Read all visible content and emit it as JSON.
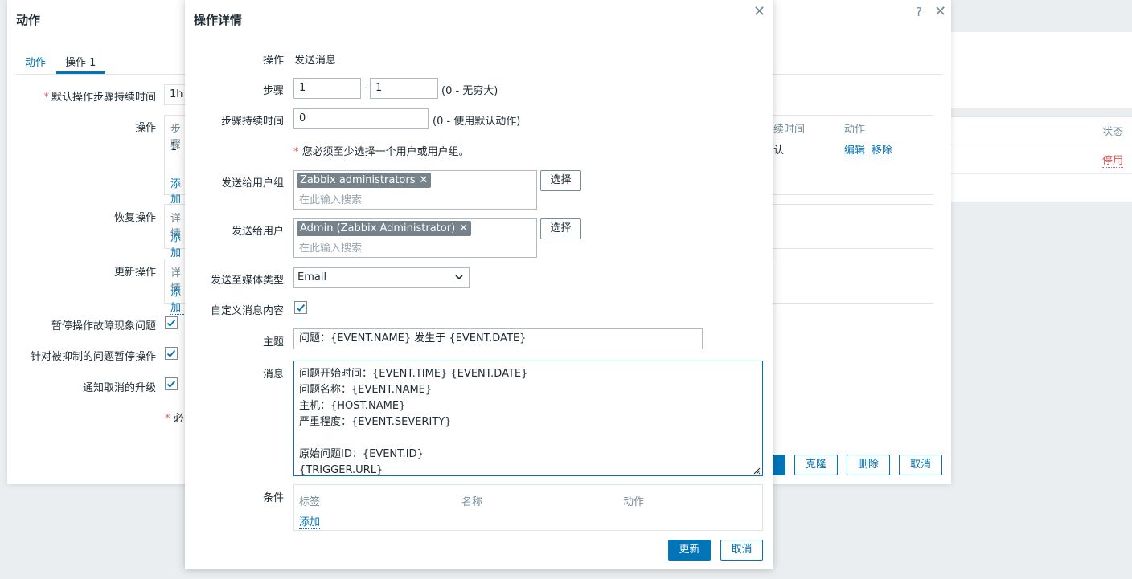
{
  "background": {
    "status_header": "状态",
    "status_value": "停用"
  },
  "back_dialog": {
    "title": "动作",
    "help_icon": "?",
    "tabs": [
      {
        "label": "动作"
      },
      {
        "label": "操作 1"
      }
    ],
    "default_duration_label": "默认操作步骤持续时间",
    "default_duration_value": "1h",
    "operations_label": "操作",
    "operations_table": {
      "col_steps_partial": "步骤",
      "row_step": "1",
      "col_duration_partial": "续时间",
      "col_action": "动作",
      "row_duration_partial": "认",
      "edit_link": "编辑",
      "remove_link": "移除",
      "add_partial": "添加"
    },
    "recovery_label": "恢复操作",
    "recovery_detail_partial": "详情",
    "recovery_add_partial": "添加",
    "update_label": "更新操作",
    "update_detail_partial": "详情",
    "update_add_partial": "添加",
    "pause_symptoms_label": "暂停操作故障现象问题",
    "pause_suppressed_label": "针对被抑制的问题暂停操作",
    "notify_cancel_label": "通知取消的升级",
    "required_note_partial": "必",
    "buttons": {
      "clone": "克隆",
      "delete": "删除",
      "cancel": "取消"
    }
  },
  "modal": {
    "title": "操作详情",
    "operation_label": "操作",
    "operation_value": "发送消息",
    "steps_label": "步骤",
    "steps_from": "1",
    "steps_to": "1",
    "steps_dash": "-",
    "steps_hint": "(0 - 无穷大)",
    "step_duration_label": "步骤持续时间",
    "step_duration_value": "0",
    "step_duration_hint": "(0 - 使用默认动作)",
    "required_star": "*",
    "required_text": "您必须至少选择一个用户或用户组。",
    "user_groups_label": "发送给用户组",
    "user_groups_tag": "Zabbix administrators",
    "user_groups_placeholder": "在此输入搜索",
    "users_label": "发送给用户",
    "users_tag": "Admin (Zabbix Administrator)",
    "users_placeholder": "在此输入搜索",
    "select_button": "选择",
    "media_type_label": "发送至媒体类型",
    "media_type_value": "Email",
    "custom_message_label": "自定义消息内容",
    "custom_message_checked": true,
    "subject_label": "主题",
    "subject_value": "问题：{EVENT.NAME} 发生于 {EVENT.DATE}",
    "message_label": "消息",
    "message_value": "问题开始时间：{EVENT.TIME} {EVENT.DATE}\n问题名称：{EVENT.NAME}\n主机：{HOST.NAME}\n严重程度：{EVENT.SEVERITY}\n\n原始问题ID：{EVENT.ID}\n{TRIGGER.URL}",
    "conditions_label": "条件",
    "conditions_table": {
      "col_label": "标签",
      "col_name": "名称",
      "col_action": "动作",
      "add_link": "添加"
    },
    "update_button": "更新",
    "cancel_button": "取消"
  },
  "colors": {
    "accent": "#0275b8",
    "required": "#e45959",
    "tag_bg": "#76838b"
  }
}
